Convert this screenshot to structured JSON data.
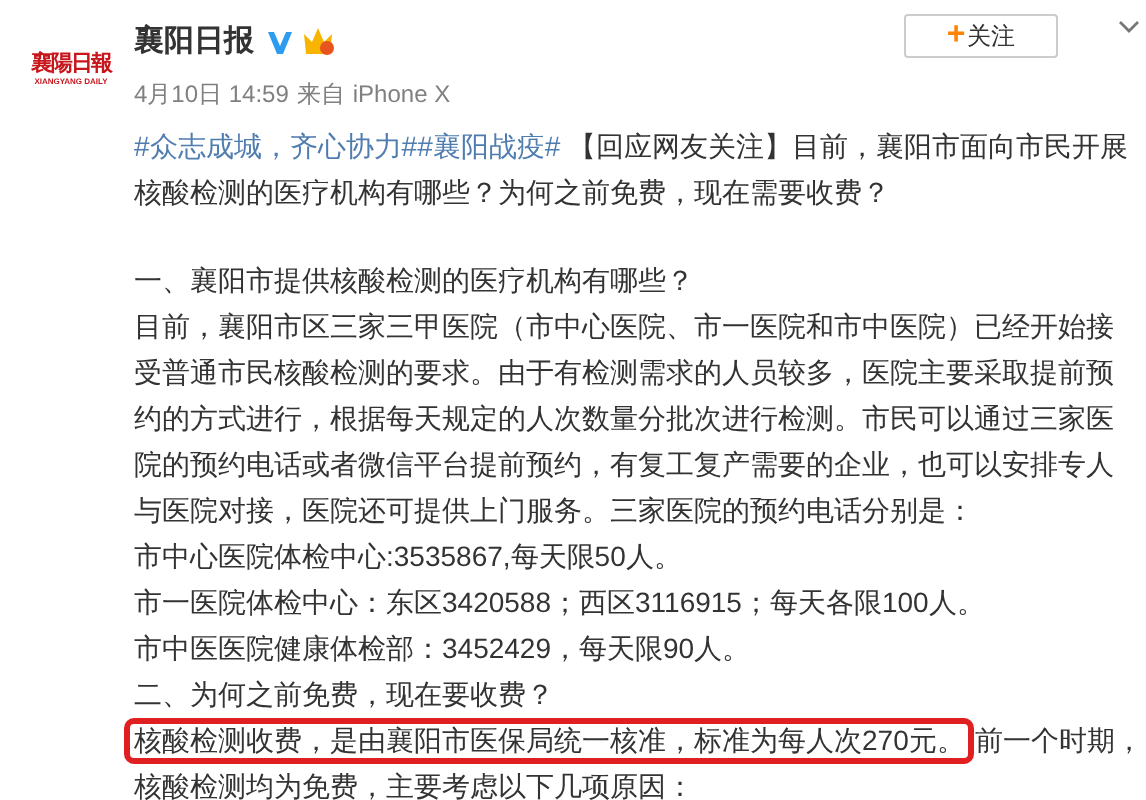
{
  "avatar": {
    "title": "襄陽日報",
    "subtitle": "XIANGYANG DAILY"
  },
  "author": {
    "name": "襄阳日报",
    "verified": true
  },
  "follow_button": {
    "icon": "+",
    "label": "关注"
  },
  "meta": {
    "date": "4月10日 14:59",
    "source_prefix": "来自",
    "source": "iPhone X"
  },
  "paragraphs": [
    {
      "segments": [
        {
          "kind": "hashtag",
          "text": "#众志成城，齐心协力#"
        },
        {
          "kind": "hashtag",
          "text": "#襄阳战疫#"
        },
        {
          "kind": "plain",
          "text": " 【回应网友关注】目前，襄阳市面向市民开展核酸检测的医疗机构有哪些？为何之前免费，现在需要收费？"
        }
      ]
    },
    {
      "segments": [
        {
          "kind": "plain",
          "text": "一、襄阳市提供核酸检测的医疗机构有哪些？"
        }
      ]
    },
    {
      "segments": [
        {
          "kind": "plain",
          "text": "目前，襄阳市区三家三甲医院（市中心医院、市一医院和市中医院）已经开始接受普通市民核酸检测的要求。由于有检测需求的人员较多，医院主要采取提前预约的方式进行，根据每天规定的人次数量分批次进行检测。市民可以通过三家医院的预约电话或者微信平台提前预约，有复工复产需要的企业，也可以安排专人与医院对接，医院还可提供上门服务。三家医院的预约电话分别是："
        }
      ]
    },
    {
      "segments": [
        {
          "kind": "plain",
          "text": "市中心医院体检中心:3535867,每天限50人。"
        }
      ]
    },
    {
      "segments": [
        {
          "kind": "plain",
          "text": "市一医院体检中心：东区3420588；西区3116915；每天各限100人。"
        }
      ]
    },
    {
      "segments": [
        {
          "kind": "plain",
          "text": "市中医医院健康体检部：3452429，每天限90人。"
        }
      ]
    },
    {
      "segments": [
        {
          "kind": "plain",
          "text": "二、为何之前免费，现在要收费？"
        }
      ]
    },
    {
      "segments": [
        {
          "kind": "highlight",
          "text": "核酸检测收费，是由襄阳市医保局统一核准，标准为每人次270元。"
        },
        {
          "kind": "plain",
          "text": "前一个时期，"
        }
      ]
    },
    {
      "segments": [
        {
          "kind": "plain",
          "text": "核酸检测均为免费，主要考虑以下几项原因："
        }
      ]
    }
  ]
}
